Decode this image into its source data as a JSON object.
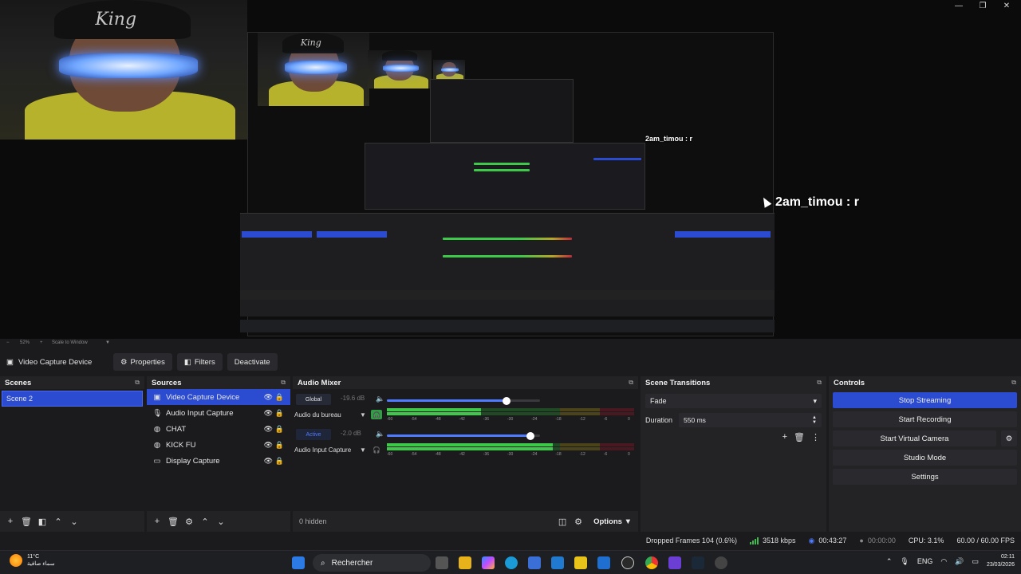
{
  "window": {
    "controls": [
      "—",
      "❐",
      "✕"
    ]
  },
  "preview": {
    "cam_text": "King",
    "chat_message_small": "2am_timou : r",
    "chat_message_large": "2am_timou : r",
    "zoom_label": "52%",
    "scale_label": "Scale to Window"
  },
  "toolbar": {
    "source_name": "Video Capture Device",
    "properties_label": "Properties",
    "filters_label": "Filters",
    "deactivate_label": "Deactivate"
  },
  "scenes": {
    "title": "Scenes",
    "items": [
      {
        "label": "Scene 2",
        "active": true
      }
    ]
  },
  "sources": {
    "title": "Sources",
    "items": [
      {
        "label": "Video Capture Device",
        "icon": "camera-icon",
        "glyph": "▣",
        "active": true
      },
      {
        "label": "Audio Input Capture",
        "icon": "microphone-icon",
        "glyph": "🎙",
        "active": false
      },
      {
        "label": "CHAT",
        "icon": "browser-globe-icon",
        "glyph": "◍",
        "active": false
      },
      {
        "label": "KICK FU",
        "icon": "browser-globe-icon",
        "glyph": "◍",
        "active": false
      },
      {
        "label": "Display Capture",
        "icon": "monitor-icon",
        "glyph": "▭",
        "active": false
      }
    ]
  },
  "mixer": {
    "title": "Audio Mixer",
    "channels": [
      {
        "badge": "Global",
        "badge_style": "plain",
        "db": "-19.6 dB",
        "volume_fraction": 0.78,
        "name": "Audio du bureau",
        "monitor_on": true,
        "level_fraction": 0.38
      },
      {
        "badge": "Active",
        "badge_style": "blue",
        "db": "-2.0 dB",
        "volume_fraction": 0.94,
        "name": "Audio Input Capture",
        "monitor_on": false,
        "level_fraction": 0.67
      }
    ],
    "ticks": [
      "-60",
      "-54",
      "-48",
      "-42",
      "-36",
      "-30",
      "-24",
      "-18",
      "-12",
      "-6",
      "0"
    ],
    "hidden_label": "0 hidden",
    "options_label": "Options"
  },
  "transitions": {
    "title": "Scene Transitions",
    "selected": "Fade",
    "duration_label": "Duration",
    "duration_value": "550 ms"
  },
  "controls": {
    "title": "Controls",
    "buttons": [
      "Stop Streaming",
      "Start Recording",
      "Start Virtual Camera",
      "Studio Mode",
      "Settings"
    ]
  },
  "status": {
    "dropped_frames": "Dropped Frames 104 (0.6%)",
    "bitrate": "3518 kbps",
    "stream_time": "00:43:27",
    "record_time": "00:00:00",
    "cpu": "CPU: 3.1%",
    "fps": "60.00 / 60.00 FPS"
  },
  "taskbar": {
    "temperature": "11°C",
    "weather_text": "سماء صافية",
    "search_placeholder": "Rechercher",
    "language": "ENG",
    "time": "02:11",
    "date": "23/03/2026"
  },
  "colors": {
    "accent": "#2b4bd1",
    "meter_green": "#3fc94a",
    "meter_yellow": "#b7a627",
    "meter_red": "#c0283a"
  }
}
